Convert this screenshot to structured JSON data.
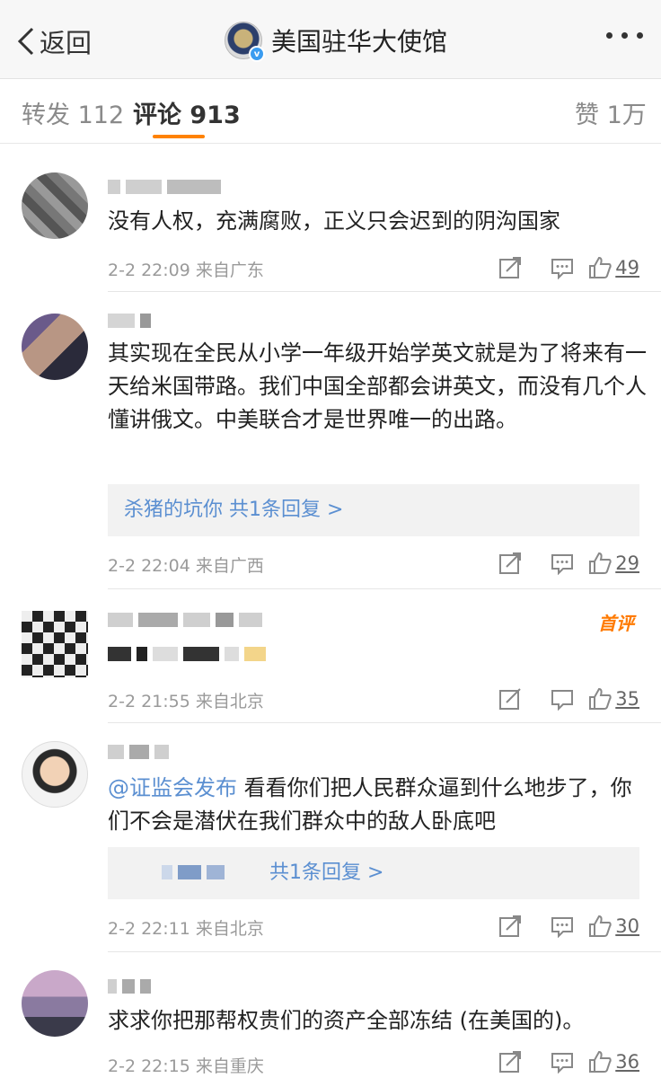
{
  "nav": {
    "back_label": "返回",
    "title": "美国驻华大使馆",
    "verified_mark": "v",
    "back_icon": "chevron-left-icon",
    "more_icon": "more-dots-icon"
  },
  "tabs": {
    "repost": "转发 112",
    "comments": "评论 913",
    "likes": "赞 1万",
    "accent_color": "#ff8200"
  },
  "comments": [
    {
      "text": "没有人权，充满腐败，正义只会迟到的阴沟国家",
      "time": "2-2 22:09",
      "source": "来自广东",
      "likes": "49"
    },
    {
      "text": "其实现在全民从小学一年级开始学英文就是为了将来有一天给米国带路。我们中国全部都会讲英文，而没有几个人懂讲俄文。中美联合才是世界唯一的出路。",
      "reply_summary": "杀猪的坑你  共1条回复 >",
      "time": "2-2 22:04",
      "source": "来自广西",
      "likes": "29"
    },
    {
      "badge": "首评",
      "time": "2-2 21:55",
      "source": "来自北京",
      "likes": "35"
    },
    {
      "mention": "@证监会发布",
      "text": " 看看你们把人民群众逼到什么地步了，你们不会是潜伏在我们群众中的敌人卧底吧",
      "reply_summary": "共1条回复 >",
      "time": "2-2 22:11",
      "source": "来自北京",
      "likes": "30"
    },
    {
      "text": "求求你把那帮权贵们的资产全部冻结 (在美国的)。",
      "time": "2-2 22:15",
      "source": "来自重庆",
      "likes": "36"
    }
  ]
}
